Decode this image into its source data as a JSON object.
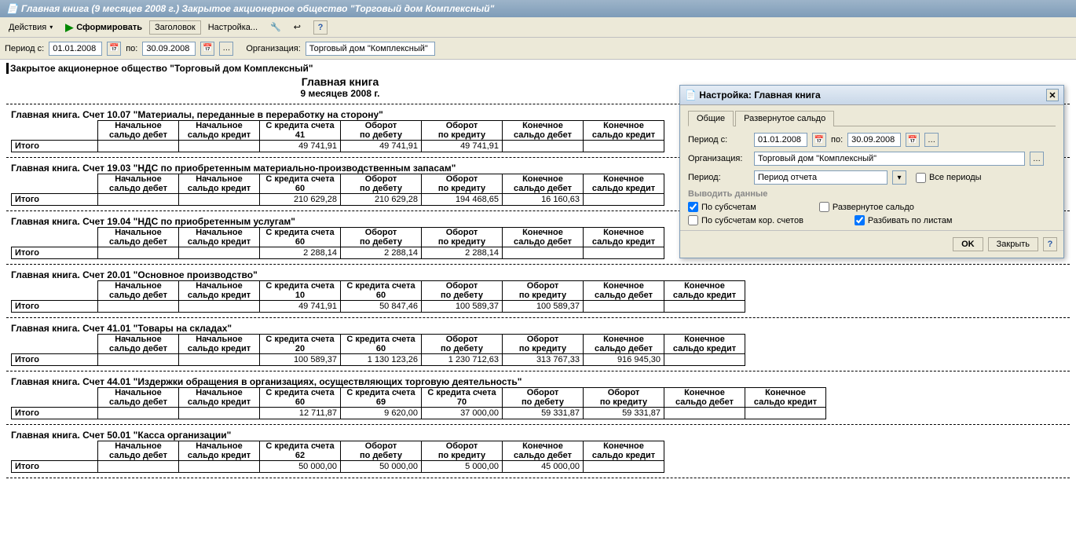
{
  "window_title": "Главная книга (9 месяцев 2008 г.) Закрытое акционерное общество \"Торговый дом Комплексный\"",
  "toolbar": {
    "actions": "Действия",
    "form": "Сформировать",
    "header": "Заголовок",
    "settings": "Настройка..."
  },
  "filter": {
    "period_from_lbl": "Период с:",
    "period_from": "01.01.2008",
    "to_lbl": "по:",
    "period_to": "30.09.2008",
    "org_lbl": "Организация:",
    "org": "Торговый дом \"Комплексный\""
  },
  "report": {
    "org": "Закрытое акционерное общество \"Торговый дом Комплексный\"",
    "title": "Главная книга",
    "subtitle": "9 месяцев 2008 г.",
    "col_nsd": "Начальное сальдо дебет",
    "col_nsk": "Начальное сальдо кредит",
    "col_od": "Оборот по дебету",
    "col_ok": "Оборот по кредиту",
    "col_ksd": "Конечное сальдо дебет",
    "col_ksk": "Конечное сальдо кредит",
    "total": "Итого",
    "sections": [
      {
        "title": "Главная книга. Счет 10.07 \"Материалы, переданные в переработку на сторону\"",
        "kcols": [
          "С кредита счета 41"
        ],
        "row": [
          "",
          "",
          "49 741,91",
          "49 741,91",
          "49 741,91",
          "",
          ""
        ]
      },
      {
        "title": "Главная книга. Счет 19.03 \"НДС по приобретенным материально-производственным запасам\"",
        "kcols": [
          "С кредита счета 60"
        ],
        "row": [
          "",
          "",
          "210 629,28",
          "210 629,28",
          "194 468,65",
          "16 160,63",
          ""
        ]
      },
      {
        "title": "Главная книга. Счет 19.04 \"НДС по приобретенным услугам\"",
        "kcols": [
          "С кредита счета 60"
        ],
        "row": [
          "",
          "",
          "2 288,14",
          "2 288,14",
          "2 288,14",
          "",
          ""
        ]
      },
      {
        "title": "Главная книга. Счет 20.01 \"Основное производство\"",
        "kcols": [
          "С кредита счета 10",
          "С кредита счета 60"
        ],
        "row": [
          "",
          "",
          "49 741,91",
          "50 847,46",
          "100 589,37",
          "100 589,37",
          "",
          ""
        ]
      },
      {
        "title": "Главная книга. Счет 41.01 \"Товары на складах\"",
        "kcols": [
          "С кредита счета 20",
          "С кредита счета 60"
        ],
        "row": [
          "",
          "",
          "100 589,37",
          "1 130 123,26",
          "1 230 712,63",
          "313 767,33",
          "916 945,30",
          ""
        ]
      },
      {
        "title": "Главная книга. Счет 44.01 \"Издержки обращения в организациях, осуществляющих торговую деятельность\"",
        "kcols": [
          "С кредита счета 60",
          "С кредита счета 69",
          "С кредита счета 70"
        ],
        "row": [
          "",
          "",
          "12 711,87",
          "9 620,00",
          "37 000,00",
          "59 331,87",
          "59 331,87",
          "",
          ""
        ]
      },
      {
        "title": "Главная книга. Счет 50.01 \"Касса организации\"",
        "kcols": [
          "С кредита счета 62"
        ],
        "row": [
          "",
          "",
          "50 000,00",
          "50 000,00",
          "5 000,00",
          "45 000,00",
          ""
        ]
      }
    ]
  },
  "dialog": {
    "title": "Настройка: Главная книга",
    "tab_general": "Общие",
    "tab_balance": "Развернутое сальдо",
    "period_from_lbl": "Период с:",
    "period_from": "01.01.2008",
    "to_lbl": "по:",
    "period_to": "30.09.2008",
    "org_lbl": "Организация:",
    "org": "Торговый дом \"Комплексный\"",
    "period_lbl": "Период:",
    "period_val": "Период отчета",
    "all_periods": "Все периоды",
    "output_data": "Выводить данные",
    "by_sub": "По субсчетам",
    "by_sub_cor": "По субсчетам кор. счетов",
    "exp_balance": "Развернутое сальдо",
    "split_sheets": "Разбивать по листам",
    "ok": "OK",
    "close": "Закрыть"
  }
}
